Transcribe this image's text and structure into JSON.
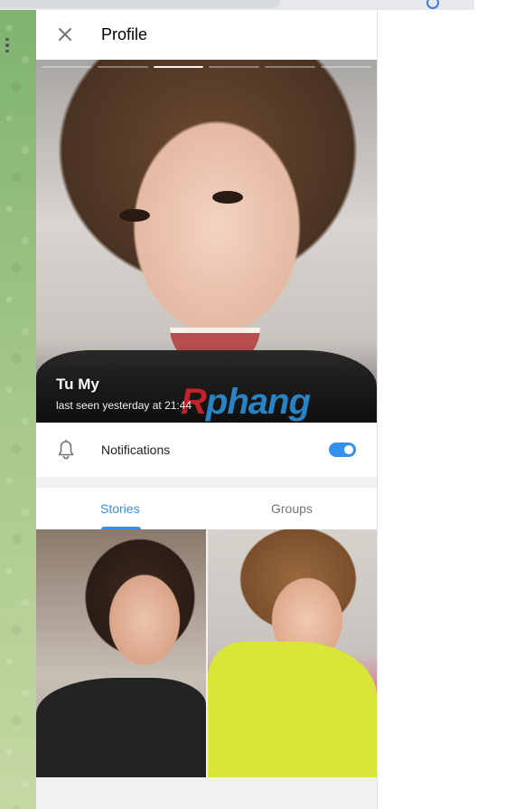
{
  "window": {
    "title": "Profile"
  },
  "header": {
    "title": "Profile",
    "close_icon": "close-icon"
  },
  "profile": {
    "name": "Tu My",
    "status": "last seen yesterday at 21:44",
    "story_segments": 6,
    "active_story_index": 3,
    "watermark": {
      "first_letter": "R",
      "rest": "phang"
    }
  },
  "notifications": {
    "label": "Notifications",
    "icon": "bell-icon",
    "enabled": true
  },
  "tabs": [
    {
      "label": "Stories",
      "active": true
    },
    {
      "label": "Groups",
      "active": false
    }
  ],
  "colors": {
    "accent": "#3390ec",
    "muted_text": "#707579",
    "watermark_red": "#d4232b",
    "watermark_blue": "#2b8fd8"
  },
  "stories_grid": [
    {
      "name": "story-thumbnail-1"
    },
    {
      "name": "story-thumbnail-2"
    }
  ]
}
